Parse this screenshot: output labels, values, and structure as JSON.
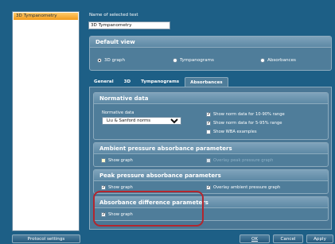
{
  "test_list": {
    "items": [
      "3D Tympanometry"
    ]
  },
  "name_section": {
    "label": "Name of selected test",
    "value": "3D Tympanometry"
  },
  "default_view": {
    "title": "Default view",
    "options": [
      {
        "label": "3D graph",
        "selected": true
      },
      {
        "label": "Tympanograms",
        "selected": false
      },
      {
        "label": "Absorbances",
        "selected": false
      }
    ]
  },
  "tabs": [
    {
      "label": "General",
      "active": false
    },
    {
      "label": "3D",
      "active": false
    },
    {
      "label": "Tympanograms",
      "active": false
    },
    {
      "label": "Absorbances",
      "active": true
    }
  ],
  "normative": {
    "title": "Normative data",
    "field_label": "Normative data",
    "selected": "Liu & Sanford norms",
    "checks": [
      {
        "label": "Show norm data for 10-90% range",
        "checked": true
      },
      {
        "label": "Show norm data for 5-95% range",
        "checked": true
      },
      {
        "label": "Show WBA examples",
        "checked": false
      }
    ]
  },
  "ambient": {
    "title": "Ambient pressure absorbance parameters",
    "show_graph": "Show graph",
    "overlay": "Overlay peak pressure graph"
  },
  "peak": {
    "title": "Peak pressure absorbance parameters",
    "show_graph": "Show graph",
    "overlay": "Overlay ambient pressure graph"
  },
  "difference": {
    "title": "Absorbance difference parameters",
    "show_graph": "Show graph"
  },
  "buttons": {
    "protocol": "Protocol settings",
    "ok": "OK",
    "cancel": "Cancel",
    "apply": "Apply"
  },
  "colors": {
    "background": "#1d5f86",
    "highlight": "#b2262e",
    "selected_item": "#f39b1c"
  }
}
